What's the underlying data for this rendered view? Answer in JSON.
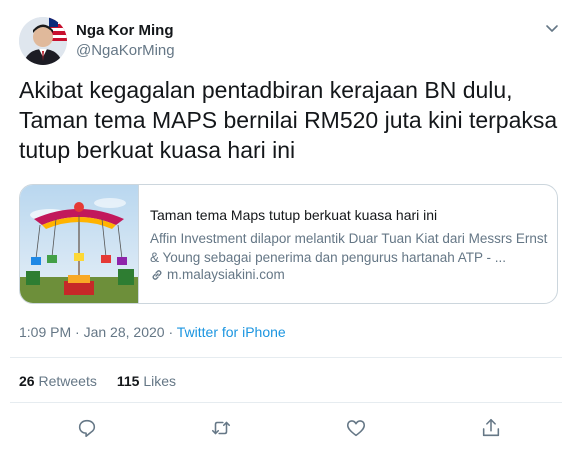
{
  "author": {
    "name": "Nga Kor Ming",
    "handle": "@NgaKorMing"
  },
  "tweet": {
    "text": "Akibat kegagalan pentadbiran kerajaan BN dulu, Taman tema MAPS bernilai RM520 juta kini terpaksa tutup berkuat kuasa hari ini"
  },
  "card": {
    "title": "Taman tema Maps tutup berkuat kuasa hari ini",
    "description": "Affin Investment dilapor melantik Duar Tuan Kiat dari Messrs Ernst & Young sebagai penerima dan pengurus hartanah ATP - ...",
    "domain": "m.malaysiakini.com"
  },
  "meta": {
    "time": "1:09 PM",
    "separator": " · ",
    "date": "Jan 28, 2020",
    "source": "Twitter for iPhone"
  },
  "stats": {
    "retweets_count": "26",
    "retweets_label": "Retweets",
    "likes_count": "115",
    "likes_label": "Likes"
  },
  "icons": {
    "reply": "reply-icon",
    "retweet": "retweet-icon",
    "like": "heart-icon",
    "share": "share-icon",
    "more": "chevron-down-icon",
    "link": "link-icon"
  },
  "colors": {
    "link_blue": "#1b95e0",
    "secondary_text": "#657786",
    "border": "#ccd6dd"
  }
}
